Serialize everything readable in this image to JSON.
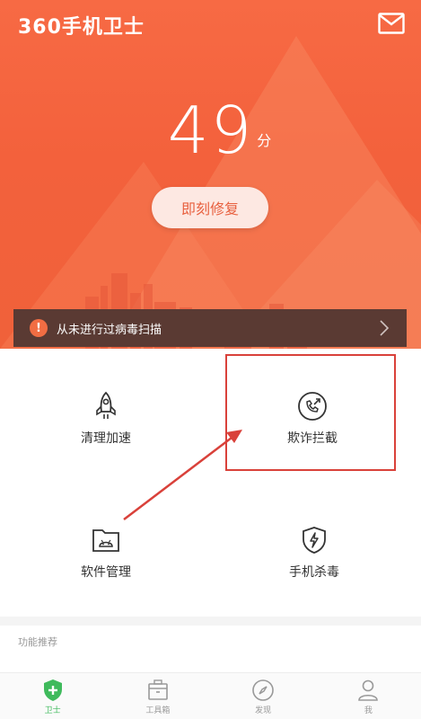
{
  "header": {
    "logo_text": "360手机卫士",
    "mail_icon": "mail-icon"
  },
  "score": {
    "value": "49",
    "unit": "分"
  },
  "fix_button": {
    "label": "即刻修复"
  },
  "alert": {
    "text": "从未进行过病毒扫描",
    "icon": "exclamation-icon"
  },
  "tools": [
    {
      "label": "清理加速",
      "icon": "rocket-icon"
    },
    {
      "label": "欺诈拦截",
      "icon": "phone-block-icon"
    },
    {
      "label": "软件管理",
      "icon": "android-folder-icon"
    },
    {
      "label": "手机杀毒",
      "icon": "shield-bolt-icon"
    }
  ],
  "section": {
    "label": "功能推荐"
  },
  "tabbar": {
    "items": [
      {
        "label": "卫士",
        "icon": "shield-plus-icon",
        "active": true
      },
      {
        "label": "工具箱",
        "icon": "toolbox-icon",
        "active": false
      },
      {
        "label": "发现",
        "icon": "compass-icon",
        "active": false
      },
      {
        "label": "我",
        "icon": "user-icon",
        "active": false
      }
    ]
  },
  "colors": {
    "hero": "#f3613c",
    "accent_green": "#3fba5c",
    "annotation_red": "#d9413a"
  }
}
